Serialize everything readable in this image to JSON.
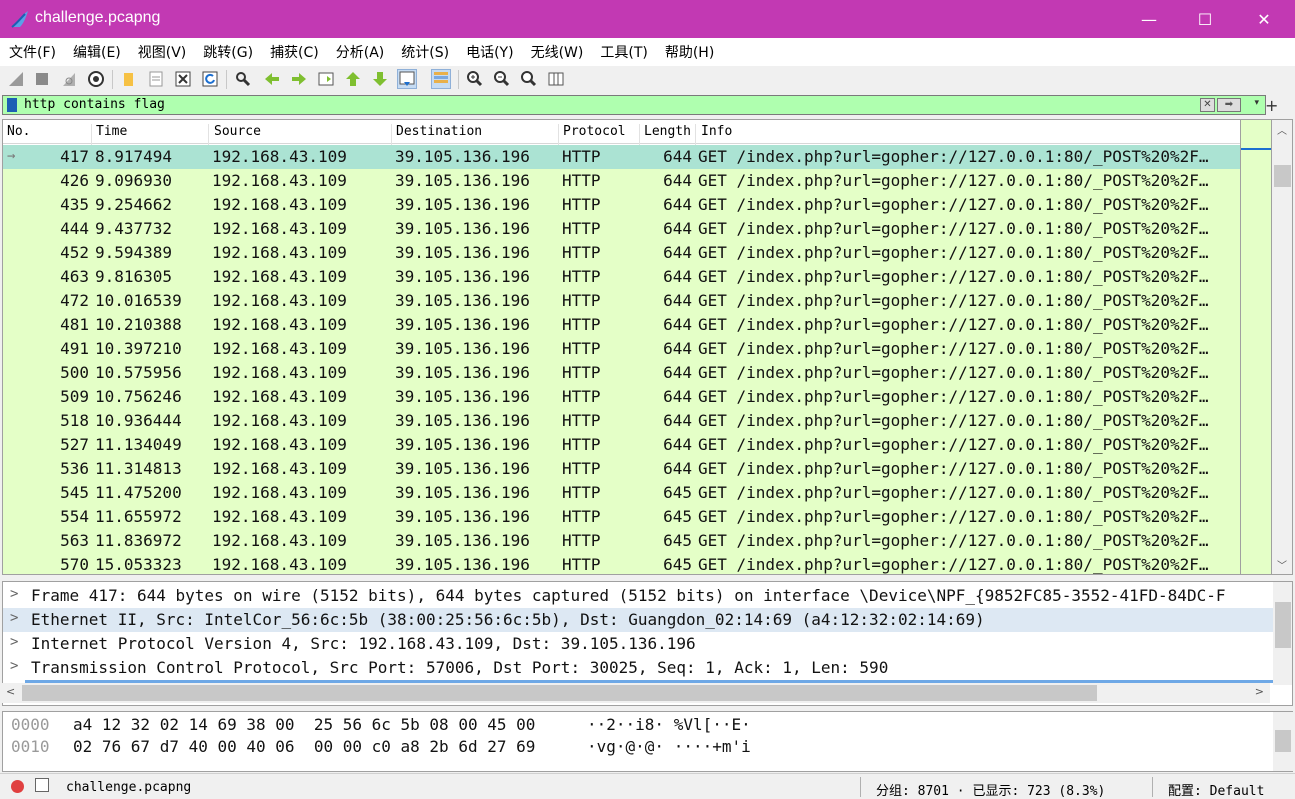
{
  "window": {
    "title": "challenge.pcapng",
    "minimize": "—",
    "maximize": "☐",
    "close": "✕"
  },
  "menu": [
    "文件(F)",
    "编辑(E)",
    "视图(V)",
    "跳转(G)",
    "捕获(C)",
    "分析(A)",
    "统计(S)",
    "电话(Y)",
    "无线(W)",
    "工具(T)",
    "帮助(H)"
  ],
  "filter": {
    "value": "http contains flag",
    "clear": "✕",
    "apply": "➡",
    "dropdown": "▾",
    "add": "+"
  },
  "columns": {
    "no": "No.",
    "time": "Time",
    "source": "Source",
    "destination": "Destination",
    "protocol": "Protocol",
    "length": "Length",
    "info": "Info"
  },
  "packets": [
    {
      "no": "417",
      "time": "8.917494",
      "src": "192.168.43.109",
      "dst": "39.105.136.196",
      "proto": "HTTP",
      "len": "644",
      "info": "GET /index.php?url=gopher://127.0.0.1:80/_POST%20%2F…"
    },
    {
      "no": "426",
      "time": "9.096930",
      "src": "192.168.43.109",
      "dst": "39.105.136.196",
      "proto": "HTTP",
      "len": "644",
      "info": "GET /index.php?url=gopher://127.0.0.1:80/_POST%20%2F…"
    },
    {
      "no": "435",
      "time": "9.254662",
      "src": "192.168.43.109",
      "dst": "39.105.136.196",
      "proto": "HTTP",
      "len": "644",
      "info": "GET /index.php?url=gopher://127.0.0.1:80/_POST%20%2F…"
    },
    {
      "no": "444",
      "time": "9.437732",
      "src": "192.168.43.109",
      "dst": "39.105.136.196",
      "proto": "HTTP",
      "len": "644",
      "info": "GET /index.php?url=gopher://127.0.0.1:80/_POST%20%2F…"
    },
    {
      "no": "452",
      "time": "9.594389",
      "src": "192.168.43.109",
      "dst": "39.105.136.196",
      "proto": "HTTP",
      "len": "644",
      "info": "GET /index.php?url=gopher://127.0.0.1:80/_POST%20%2F…"
    },
    {
      "no": "463",
      "time": "9.816305",
      "src": "192.168.43.109",
      "dst": "39.105.136.196",
      "proto": "HTTP",
      "len": "644",
      "info": "GET /index.php?url=gopher://127.0.0.1:80/_POST%20%2F…"
    },
    {
      "no": "472",
      "time": "10.016539",
      "src": "192.168.43.109",
      "dst": "39.105.136.196",
      "proto": "HTTP",
      "len": "644",
      "info": "GET /index.php?url=gopher://127.0.0.1:80/_POST%20%2F…"
    },
    {
      "no": "481",
      "time": "10.210388",
      "src": "192.168.43.109",
      "dst": "39.105.136.196",
      "proto": "HTTP",
      "len": "644",
      "info": "GET /index.php?url=gopher://127.0.0.1:80/_POST%20%2F…"
    },
    {
      "no": "491",
      "time": "10.397210",
      "src": "192.168.43.109",
      "dst": "39.105.136.196",
      "proto": "HTTP",
      "len": "644",
      "info": "GET /index.php?url=gopher://127.0.0.1:80/_POST%20%2F…"
    },
    {
      "no": "500",
      "time": "10.575956",
      "src": "192.168.43.109",
      "dst": "39.105.136.196",
      "proto": "HTTP",
      "len": "644",
      "info": "GET /index.php?url=gopher://127.0.0.1:80/_POST%20%2F…"
    },
    {
      "no": "509",
      "time": "10.756246",
      "src": "192.168.43.109",
      "dst": "39.105.136.196",
      "proto": "HTTP",
      "len": "644",
      "info": "GET /index.php?url=gopher://127.0.0.1:80/_POST%20%2F…"
    },
    {
      "no": "518",
      "time": "10.936444",
      "src": "192.168.43.109",
      "dst": "39.105.136.196",
      "proto": "HTTP",
      "len": "644",
      "info": "GET /index.php?url=gopher://127.0.0.1:80/_POST%20%2F…"
    },
    {
      "no": "527",
      "time": "11.134049",
      "src": "192.168.43.109",
      "dst": "39.105.136.196",
      "proto": "HTTP",
      "len": "644",
      "info": "GET /index.php?url=gopher://127.0.0.1:80/_POST%20%2F…"
    },
    {
      "no": "536",
      "time": "11.314813",
      "src": "192.168.43.109",
      "dst": "39.105.136.196",
      "proto": "HTTP",
      "len": "644",
      "info": "GET /index.php?url=gopher://127.0.0.1:80/_POST%20%2F…"
    },
    {
      "no": "545",
      "time": "11.475200",
      "src": "192.168.43.109",
      "dst": "39.105.136.196",
      "proto": "HTTP",
      "len": "645",
      "info": "GET /index.php?url=gopher://127.0.0.1:80/_POST%20%2F…"
    },
    {
      "no": "554",
      "time": "11.655972",
      "src": "192.168.43.109",
      "dst": "39.105.136.196",
      "proto": "HTTP",
      "len": "645",
      "info": "GET /index.php?url=gopher://127.0.0.1:80/_POST%20%2F…"
    },
    {
      "no": "563",
      "time": "11.836972",
      "src": "192.168.43.109",
      "dst": "39.105.136.196",
      "proto": "HTTP",
      "len": "645",
      "info": "GET /index.php?url=gopher://127.0.0.1:80/_POST%20%2F…"
    },
    {
      "no": "570",
      "time": "15.053323",
      "src": "192.168.43.109",
      "dst": "39.105.136.196",
      "proto": "HTTP",
      "len": "645",
      "info": "GET /index.php?url=gopher://127.0.0.1:80/_POST%20%2F…"
    }
  ],
  "details": [
    "Frame 417: 644 bytes on wire (5152 bits), 644 bytes captured (5152 bits) on interface \\Device\\NPF_{9852FC85-3552-41FD-84DC-F",
    "Ethernet II, Src: IntelCor_56:6c:5b (38:00:25:56:6c:5b), Dst: Guangdon_02:14:69 (a4:12:32:02:14:69)",
    "Internet Protocol Version 4, Src: 192.168.43.109, Dst: 39.105.136.196",
    "Transmission Control Protocol, Src Port: 57006, Dst Port: 30025, Seq: 1, Ack: 1, Len: 590"
  ],
  "bytes": [
    {
      "offset": "0000",
      "hex": "a4 12 32 02 14 69 38 00  25 56 6c 5b 08 00 45 00",
      "ascii": "··2··i8· %Vl[··E·"
    },
    {
      "offset": "0010",
      "hex": "02 76 67 d7 40 00 40 06  00 00 c0 a8 2b 6d 27 69",
      "ascii": "·vg·@·@· ····+m'i"
    }
  ],
  "status": {
    "file": "challenge.pcapng",
    "stats": "分组: 8701 · 已显示: 723 (8.3%)",
    "profile": "配置: Default"
  },
  "colors": {
    "titlebar": "#c239b3",
    "row": "#e4ffc7",
    "selected": "#abe3d3",
    "filter": "#afffaf"
  }
}
